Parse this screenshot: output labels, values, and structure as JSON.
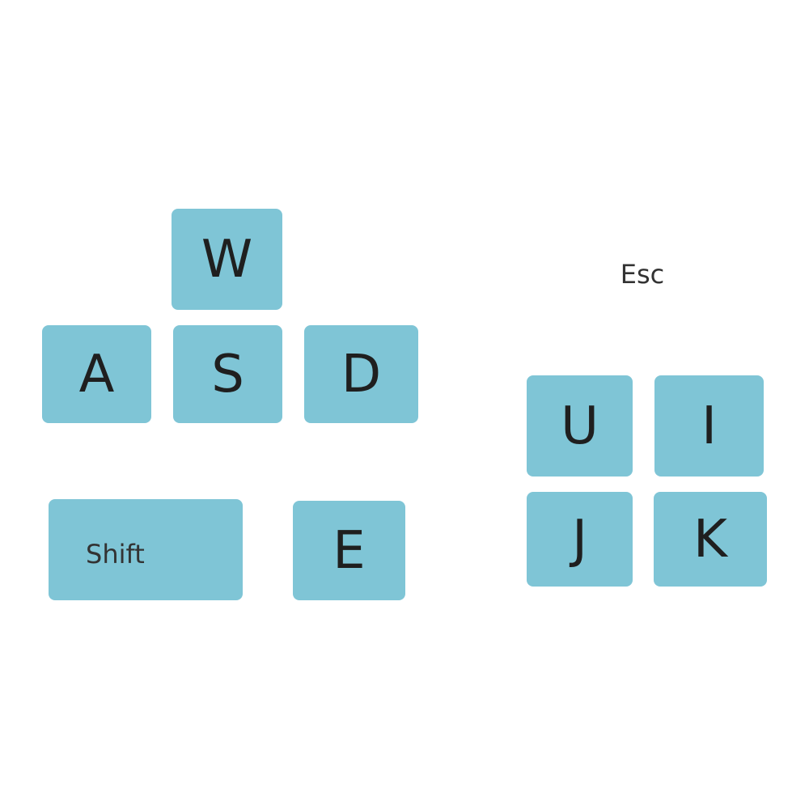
{
  "keys": {
    "w": "W",
    "a": "A",
    "s": "S",
    "d": "D",
    "shift": "Shift",
    "e": "E",
    "esc": "Esc",
    "u": "U",
    "i": "I",
    "j": "J",
    "k": "K"
  },
  "colors": {
    "key_fill": "#7fc5d6",
    "key_text": "#1f1f1f",
    "background": "#ffffff"
  }
}
